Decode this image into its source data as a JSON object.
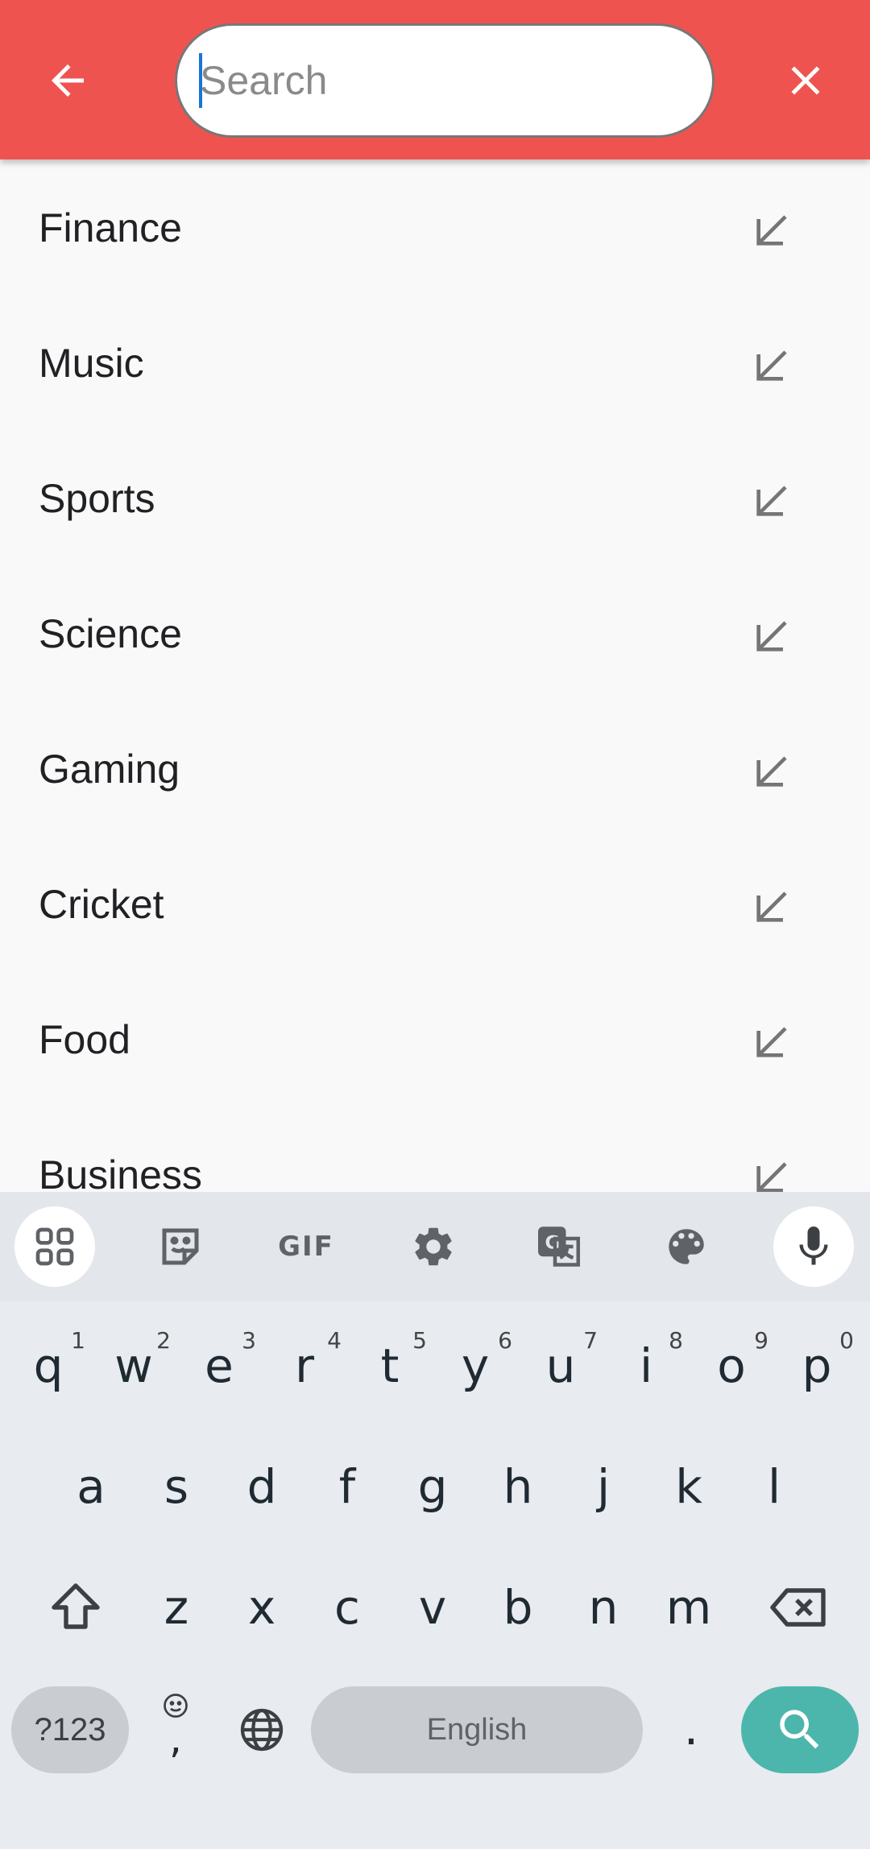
{
  "search": {
    "placeholder": "Search",
    "value": ""
  },
  "suggestions": [
    "Finance",
    "Music",
    "Sports",
    "Science",
    "Gaming",
    "Cricket",
    "Food",
    "Business"
  ],
  "keyboard": {
    "toolbar": {
      "gif_label": "GIF"
    },
    "row1": [
      {
        "key": "q",
        "hint": "1"
      },
      {
        "key": "w",
        "hint": "2"
      },
      {
        "key": "e",
        "hint": "3"
      },
      {
        "key": "r",
        "hint": "4"
      },
      {
        "key": "t",
        "hint": "5"
      },
      {
        "key": "y",
        "hint": "6"
      },
      {
        "key": "u",
        "hint": "7"
      },
      {
        "key": "i",
        "hint": "8"
      },
      {
        "key": "o",
        "hint": "9"
      },
      {
        "key": "p",
        "hint": "0"
      }
    ],
    "row2": [
      "a",
      "s",
      "d",
      "f",
      "g",
      "h",
      "j",
      "k",
      "l"
    ],
    "row3": [
      "z",
      "x",
      "c",
      "v",
      "b",
      "n",
      "m"
    ],
    "symbols_label": "?123",
    "comma_label": ",",
    "space_label": "English",
    "period_label": "."
  },
  "colors": {
    "appbar": "#ef5350",
    "accent": "#4db6ac",
    "caret": "#1976d2"
  },
  "icons": [
    "arrow-back-icon",
    "close-icon",
    "arrow-up-left-icon",
    "apps-grid-icon",
    "sticker-icon",
    "settings-icon",
    "translate-icon",
    "palette-icon",
    "microphone-icon",
    "shift-icon",
    "backspace-icon",
    "emoji-icon",
    "globe-icon",
    "search-icon"
  ]
}
